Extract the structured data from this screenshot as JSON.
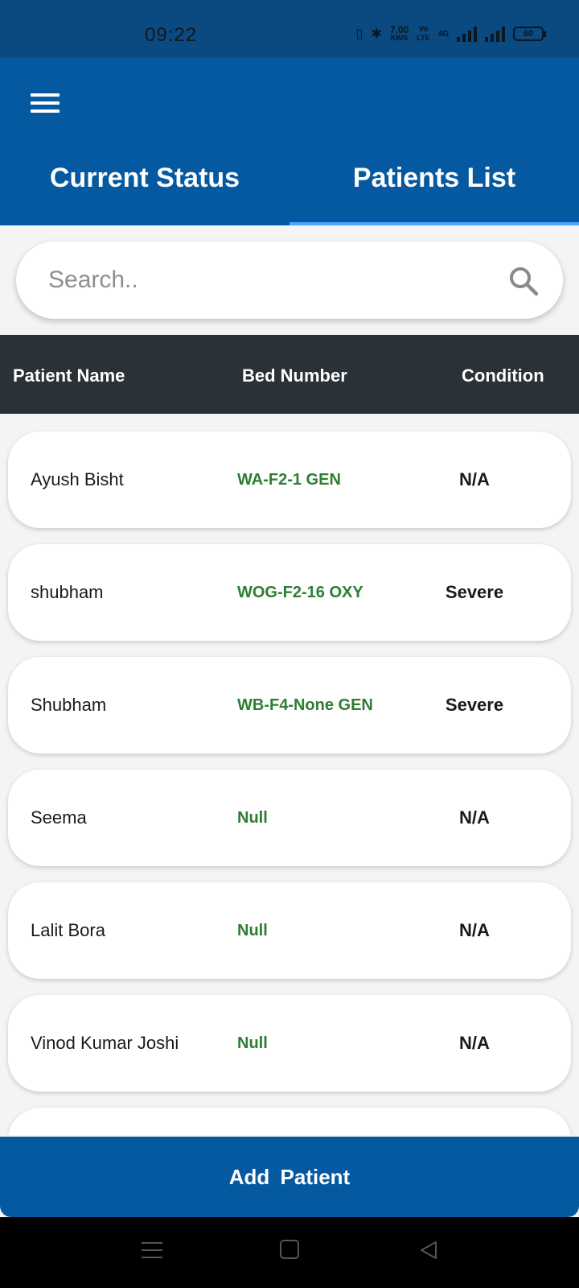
{
  "status_bar": {
    "time": "09:22",
    "net_speed_value": "7.00",
    "net_speed_unit": "KB/S",
    "volte": "Vo",
    "lte": "LTE",
    "network": "4G",
    "battery": "60"
  },
  "header": {
    "tabs": [
      {
        "label": "Current Status",
        "selected": false
      },
      {
        "label": "Patients List",
        "selected": true
      }
    ]
  },
  "search": {
    "placeholder": "Search..",
    "value": ""
  },
  "table": {
    "columns": [
      "Patient Name",
      "Bed Number",
      "Condition"
    ],
    "rows": [
      {
        "name": "Ayush Bisht",
        "bed": "WA-F2-1 GEN",
        "condition": "N/A"
      },
      {
        "name": "shubham",
        "bed": "WOG-F2-16 OXY",
        "condition": "Severe"
      },
      {
        "name": "Shubham",
        "bed": "WB-F4-None GEN",
        "condition": "Severe"
      },
      {
        "name": "Seema",
        "bed": "Null",
        "condition": "N/A"
      },
      {
        "name": "Lalit Bora",
        "bed": "Null",
        "condition": "N/A"
      },
      {
        "name": "Vinod Kumar Joshi",
        "bed": "Null",
        "condition": "N/A"
      },
      {
        "name": "",
        "bed": "",
        "condition": ""
      }
    ]
  },
  "actions": {
    "add_patient_label": "Add  Patient"
  },
  "colors": {
    "primary": "#0559a0",
    "status_bar": "#0a4a80",
    "table_header": "#2a3137",
    "bed_text": "#2e7d32",
    "tab_indicator": "#4da3ff"
  },
  "icons": {
    "menu": "hamburger-menu-icon",
    "search": "search-icon",
    "nav_recent": "recent-apps-icon",
    "nav_home": "home-icon",
    "nav_back": "back-icon"
  }
}
